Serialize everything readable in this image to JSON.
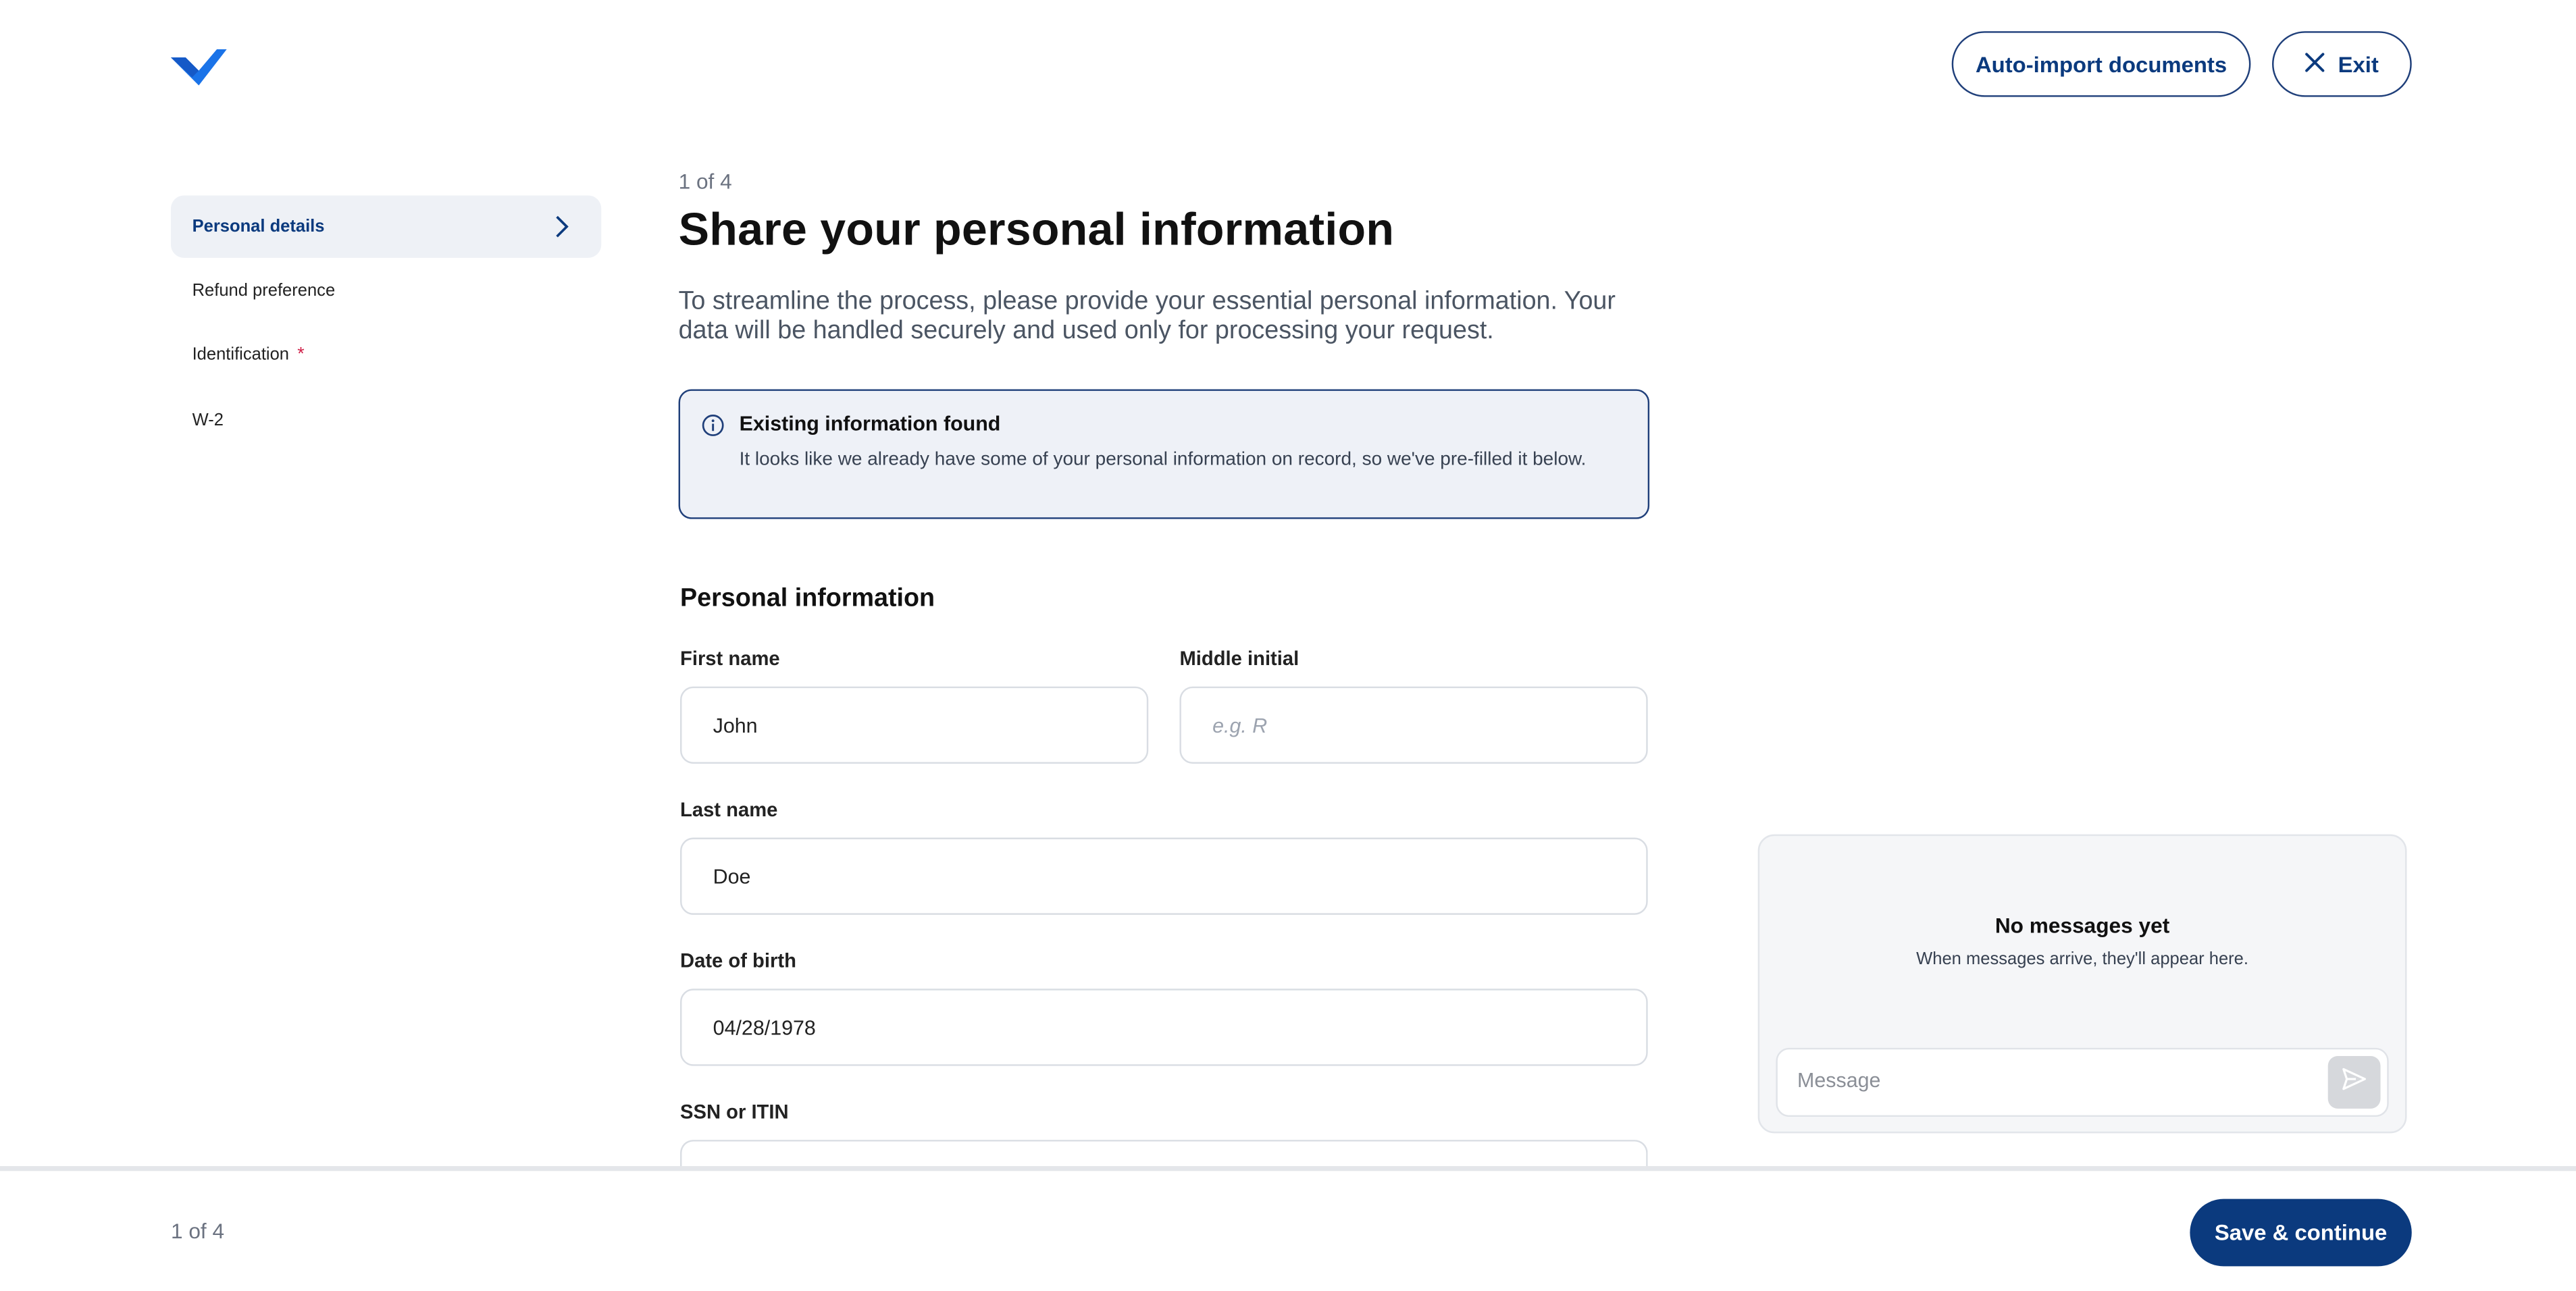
{
  "header": {
    "auto_import_label": "Auto-import documents",
    "exit_label": "Exit"
  },
  "sidebar": {
    "items": [
      {
        "label": "Personal details",
        "active": true
      },
      {
        "label": "Refund preference"
      },
      {
        "label": "Identification",
        "required_marker": "*"
      },
      {
        "label": "W-2"
      }
    ]
  },
  "main": {
    "step": "1 of 4",
    "title": "Share your personal information",
    "intro": "To streamline the process, please provide your essential personal information. Your data will be handled securely and used only for processing your request.",
    "info": {
      "title": "Existing information found",
      "text": "It looks like we already have some of your personal information on record, so we've pre-filled it below."
    },
    "section_title": "Personal information",
    "fields": {
      "first_name": {
        "label": "First name",
        "value": "John"
      },
      "middle_initial": {
        "label": "Middle initial",
        "placeholder": "e.g. R"
      },
      "last_name": {
        "label": "Last name",
        "value": "Doe"
      },
      "dob": {
        "label": "Date of birth",
        "value": "04/28/1978"
      },
      "ssn": {
        "label": "SSN or ITIN",
        "value": ""
      }
    }
  },
  "chat": {
    "empty_title": "No messages yet",
    "empty_sub": "When messages arrive, they'll appear here.",
    "input_placeholder": "Message"
  },
  "footer": {
    "step": "1 of 4",
    "save_label": "Save & continue"
  },
  "colors": {
    "brand": "#0b3a7e",
    "logo": "#1a73e8",
    "active_nav_bg": "#eef1f6",
    "info_bg": "#eef1f7",
    "required": "#d0224a"
  },
  "icons": {
    "logo": "check-logo-icon",
    "exit": "close-icon",
    "nav_active": "chevron-right-icon",
    "info": "info-icon",
    "send": "send-icon"
  }
}
